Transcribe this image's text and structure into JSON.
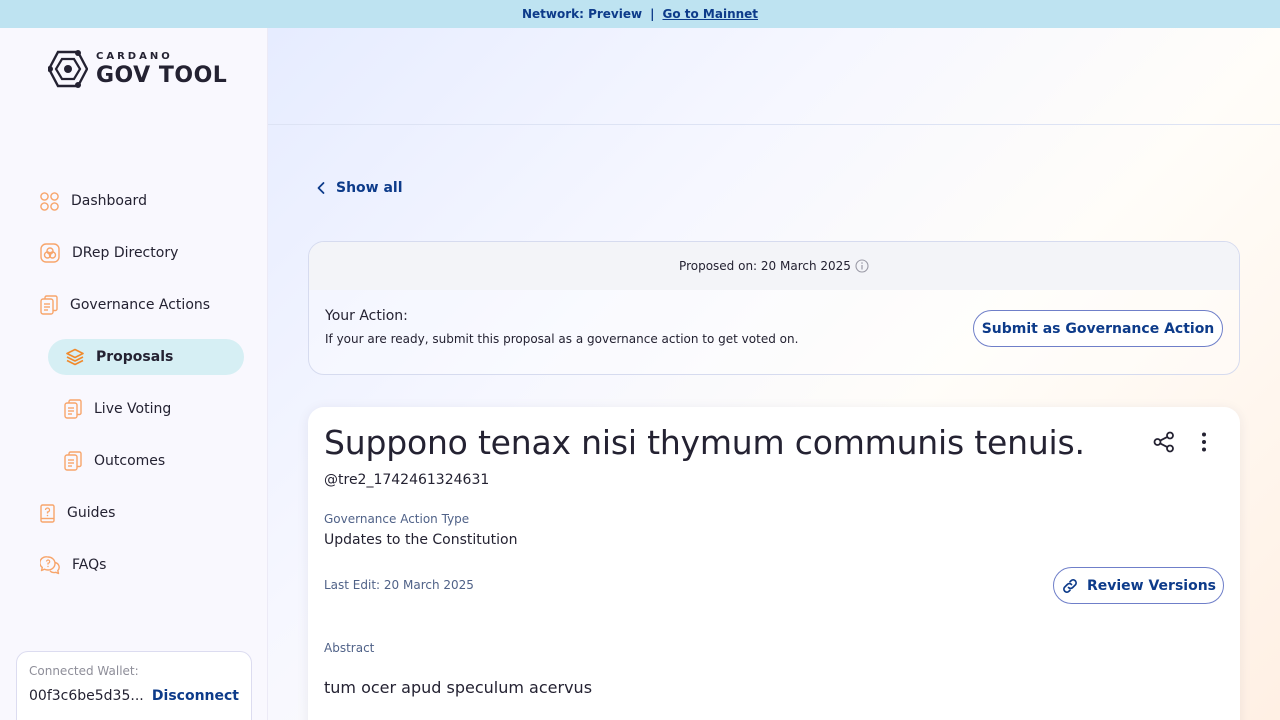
{
  "banner": {
    "network_text": "Network: Preview",
    "separator": "|",
    "link": "Go to Mainnet"
  },
  "logo": {
    "small": "CARDANO",
    "big": "GOV TOOL"
  },
  "nav": {
    "dashboard": "Dashboard",
    "drep_directory": "DRep Directory",
    "governance_actions": "Governance Actions",
    "proposals": "Proposals",
    "live_voting": "Live Voting",
    "outcomes": "Outcomes",
    "guides": "Guides",
    "faqs": "FAQs"
  },
  "wallet": {
    "label": "Connected Wallet:",
    "address": "00f3c6be5d35...",
    "disconnect": "Disconnect"
  },
  "back_link": "Show all",
  "action_card": {
    "proposed_on": "Proposed on: 20 March 2025",
    "title": "Your Action:",
    "description": "If your are ready, submit this proposal as a governance action to get voted on.",
    "submit_button": "Submit as Governance Action"
  },
  "proposal": {
    "title": "Suppono tenax nisi thymum communis tenuis.",
    "username": "@tre2_1742461324631",
    "type_label": "Governance Action Type",
    "type_value": "Updates to the Constitution",
    "last_edit": "Last Edit: 20 March 2025",
    "review_button": "Review Versions",
    "abstract_label": "Abstract",
    "abstract_value": "tum ocer apud speculum acervus"
  },
  "colors": {
    "accent_blue": "#0d3b8a",
    "banner_bg": "#bee3f1",
    "nav_active_bg": "#d6eff4",
    "icon_orange": "#f7a56b"
  }
}
